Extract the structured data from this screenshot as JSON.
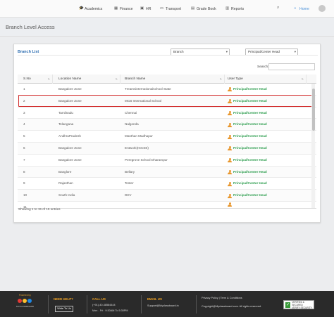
{
  "nav": {
    "items": [
      {
        "label": "Academics",
        "icon": "graduation-cap-icon"
      },
      {
        "label": "Finance",
        "icon": "finance-icon"
      },
      {
        "label": "HR",
        "icon": "briefcase-icon"
      },
      {
        "label": "Transport",
        "icon": "bus-icon"
      },
      {
        "label": "Grade Book",
        "icon": "book-icon"
      },
      {
        "label": "Reports",
        "icon": "chart-icon"
      }
    ],
    "home_label": "Home"
  },
  "page": {
    "title": "Branch Level Access"
  },
  "card": {
    "title": "Branch List",
    "select_branch": "Branch",
    "select_role": "Principal/Center Head",
    "search_label": "Search:",
    "showing": "Showing 1 to 15 of 15 entries"
  },
  "table": {
    "headers": [
      "S.No",
      "Location Name",
      "Branch Name",
      "User Type"
    ],
    "rows": [
      {
        "sno": "1",
        "location": "Bangalore Zone",
        "branch": "Treamsinternationalschool State",
        "user": "Principal/Center Head"
      },
      {
        "sno": "2",
        "location": "Bangalore Zone",
        "branch": "MCB International School",
        "user": "Principal/Center Head"
      },
      {
        "sno": "3",
        "location": "Tamilnadu",
        "branch": "Chennai",
        "user": "Principal/Center Head"
      },
      {
        "sno": "4",
        "location": "Telangana",
        "branch": "Nalgonda",
        "user": "Principal/Center Head"
      },
      {
        "sno": "5",
        "location": "AndhraPradesh",
        "branch": "Manthan Madhapur",
        "user": "Principal/Center Head"
      },
      {
        "sno": "6",
        "location": "Bangalore Zone",
        "branch": "Entwork(IGCSE)",
        "user": "Principal/Center Head"
      },
      {
        "sno": "7",
        "location": "Bangalore Zone",
        "branch": "Peregrove School Dharampur",
        "user": "Principal/Center Head"
      },
      {
        "sno": "8",
        "location": "Banglore",
        "branch": "Bellary",
        "user": "Principal/Center Head"
      },
      {
        "sno": "9",
        "location": "Rajasthan",
        "branch": "Tester",
        "user": "Principal/Center Head"
      },
      {
        "sno": "10",
        "location": "South India",
        "branch": "DKV",
        "user": "Principal/Center Head"
      },
      {
        "sno": "11",
        "location": "",
        "branch": "",
        "user": ""
      }
    ]
  },
  "footer": {
    "powered_by": "Powered by",
    "brand": "MYCLASSBOARD",
    "need_help": "NEED HELP?",
    "write_to_us": "Write To Us",
    "call_us": "CALL US",
    "phone": "(+91)-40-48584444",
    "hours": "Mon - Fri : 9:30AM To 5:30PM",
    "email_us": "EMAIL US",
    "email": "Support@Myclassboard.in",
    "policy": "Privacy Policy | Term & Conditions",
    "copyright": "Copyright@Myclassboard.com. All rights reserved.",
    "badge": "VERIFIED & SECURED",
    "badge_sub": "VERIFY SECURITY"
  },
  "colors": {
    "accent": "#2b6cb0",
    "user_type": "#2e9e4f",
    "highlight": "#d32f2f",
    "footer_bg": "#2a2a2a",
    "footer_heading": "#f5a623"
  }
}
